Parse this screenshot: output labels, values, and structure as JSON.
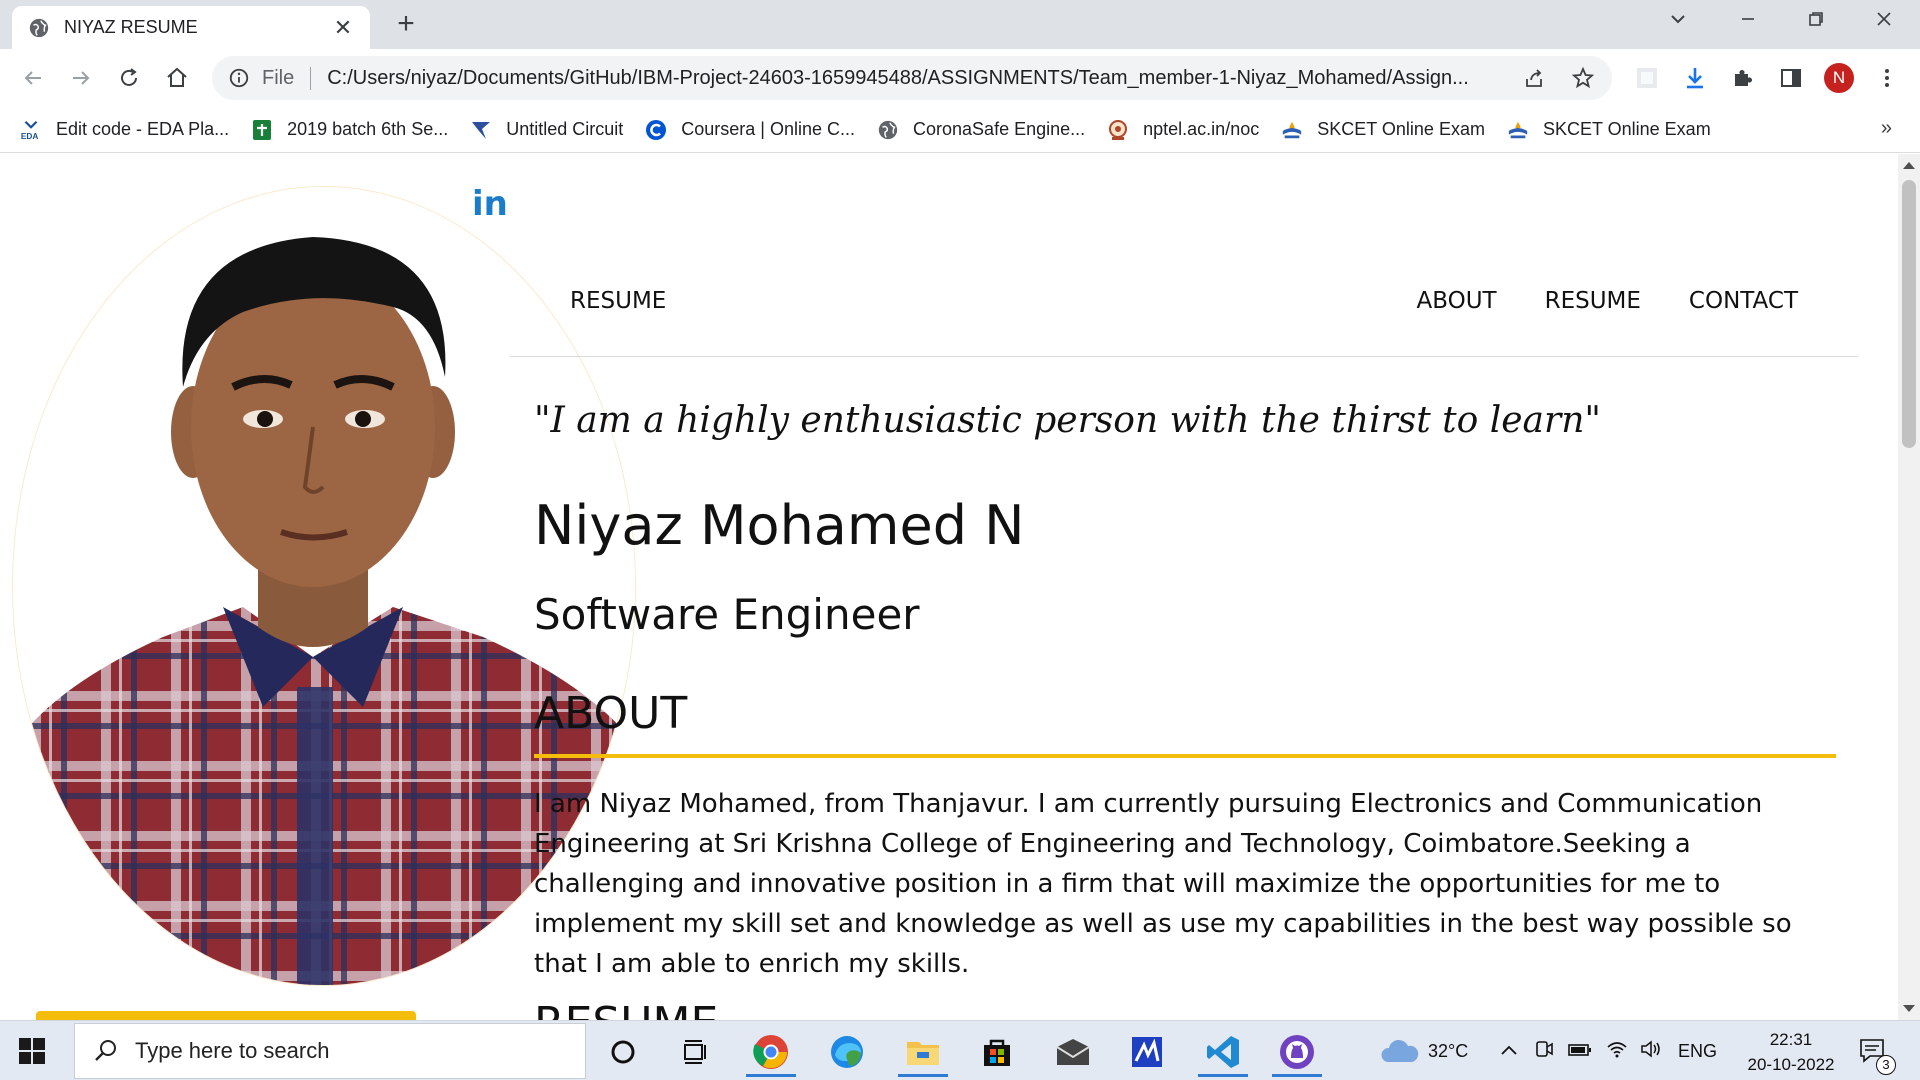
{
  "browser": {
    "tab_title": "NIYAZ RESUME",
    "scheme_label": "File",
    "url": "C:/Users/niyaz/Documents/GitHub/IBM-Project-24603-1659945488/ASSIGNMENTS/Team_member-1-Niyaz_Mohamed/Assign...",
    "profile_initial": "N"
  },
  "bookmarks": [
    {
      "label": "Edit code - EDA Pla...",
      "icon": "eda-icon"
    },
    {
      "label": "2019 batch 6th Se...",
      "icon": "sheets-icon"
    },
    {
      "label": "Untitled Circuit",
      "icon": "circuit-icon"
    },
    {
      "label": "Coursera | Online C...",
      "icon": "coursera-icon"
    },
    {
      "label": "CoronaSafe Engine...",
      "icon": "globe-icon"
    },
    {
      "label": "nptel.ac.in/noc",
      "icon": "nptel-icon"
    },
    {
      "label": "SKCET Online Exam",
      "icon": "skcet-icon"
    },
    {
      "label": "SKCET Online Exam",
      "icon": "skcet-icon"
    }
  ],
  "page": {
    "brand": "RESUME",
    "nav": [
      "ABOUT",
      "RESUME",
      "CONTACT"
    ],
    "linkedin_label": "in",
    "quote": "\"I am a highly enthusiastic person with the thirst to learn\"",
    "name": "Niyaz Mohamed N",
    "role": "Software Engineer",
    "about_heading": "ABOUT",
    "about_text": "I am Niyaz Mohamed, from Thanjavur. I am currently pursuing Electronics and Communication Engineering at Sri Krishna College of Engineering and Technology, Coimbatore.Seeking a challenging and innovative position in a firm that will maximize the opportunities for me to implement my skill set and knowledge as well as use my capabilities in the best way possible so that I am able to enrich my skills.",
    "resume_heading": "RESUME",
    "accent_color": "#f4bd0b"
  },
  "taskbar": {
    "search_placeholder": "Type here to search",
    "weather": "32°C",
    "language": "ENG",
    "time": "22:31",
    "date": "20-10-2022",
    "notification_count": "3"
  }
}
